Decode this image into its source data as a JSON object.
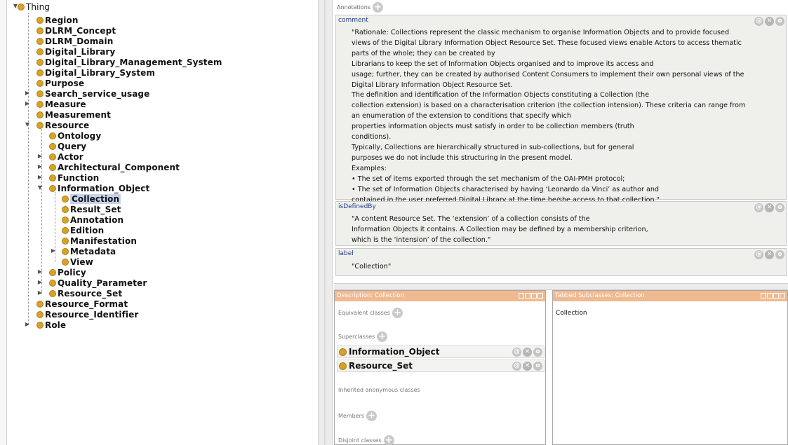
{
  "tree": {
    "root": "Thing",
    "items": [
      {
        "label": "Region"
      },
      {
        "label": "DLRM_Concept"
      },
      {
        "label": "DLRM_Domain"
      },
      {
        "label": "Digital_Library"
      },
      {
        "label": "Digital_Library_Management_System"
      },
      {
        "label": "Digital_Library_System"
      },
      {
        "label": "Purpose"
      },
      {
        "label": "Search_service_usage"
      },
      {
        "label": "Measure"
      },
      {
        "label": "Measurement"
      },
      {
        "label": "Resource"
      },
      {
        "label": "Ontology"
      },
      {
        "label": "Query"
      },
      {
        "label": "Actor"
      },
      {
        "label": "Architectural_Component"
      },
      {
        "label": "Function"
      },
      {
        "label": "Information_Object"
      },
      {
        "label": "Collection"
      },
      {
        "label": "Result_Set"
      },
      {
        "label": "Annotation"
      },
      {
        "label": "Edition"
      },
      {
        "label": "Manifestation"
      },
      {
        "label": "Metadata"
      },
      {
        "label": "View"
      },
      {
        "label": "Policy"
      },
      {
        "label": "Quality_Parameter"
      },
      {
        "label": "Resource_Set"
      },
      {
        "label": "Resource_Format"
      },
      {
        "label": "Resource_Identifier"
      },
      {
        "label": "Role"
      }
    ]
  },
  "annotations": {
    "header": "Annotations",
    "blocks": [
      {
        "property": "comment",
        "value": "\"Rationale: Collections represent the classic mechanism to organise Information Objects and to provide focused\nviews of the Digital Library Information Object Resource Set. These focused views enable Actors to access thematic\nparts of the whole; they can be created by\nLibrarians to keep the set of Information Objects organised and to improve its access and\nusage; further, they can be created by authorised Content Consumers to implement their own personal views of the\nDigital Library Information Object Resource Set.\nThe definition and identification of the Information Objects constituting a Collection (the\ncollection extension) is based on a characterisation criterion (the collection intension). These criteria can range from\nan enumeration of the extension to conditions that specify which\nproperties information objects must satisfy in order to be collection members (truth\nconditions).\nTypically, Collections are hierarchically structured in sub-collections, but for general\npurposes we do not include this structuring in the present model.\nExamples:\n• The set of items exported through the set mechanism of the OAI-PMH protocol;\n• The set of Information Objects characterised by having ‘Leonardo da Vinci’ as author and\ncontained in the user preferred Digital Library at the time he/she access to that collection.\""
      },
      {
        "property": "isDefinedBy",
        "value": "\"A content Resource Set. The ‘extension’ of a collection consists of the\nInformation Objects it contains. A Collection may be defined by a membership criterion,\nwhich is the ‘intension’ of the collection.\""
      },
      {
        "property": "label",
        "value": "\"Collection\""
      }
    ]
  },
  "description": {
    "title": "Description: Collection",
    "equivalent": "Equivalent classes",
    "superclasses": "Superclasses",
    "superclass_items": [
      "Information_Object",
      "Resource_Set"
    ],
    "inherited": "Inherited anonymous classes",
    "members": "Members",
    "disjoint": "Disjoint classes"
  },
  "tabbed": {
    "title": "Tabbed Subclasses: Collection",
    "item": "Collection"
  },
  "colors": {
    "class_dot": "#d6a22a",
    "panel_title": "#f0b98f",
    "annotation_bg": "#eff0eb",
    "property_link": "#1f3c86",
    "selection": "#c5d3ea"
  },
  "icons": [
    "expand-arrow-icon",
    "collapse-arrow-icon",
    "class-dot-icon",
    "add-icon",
    "annotate-icon",
    "delete-icon",
    "edit-icon"
  ]
}
